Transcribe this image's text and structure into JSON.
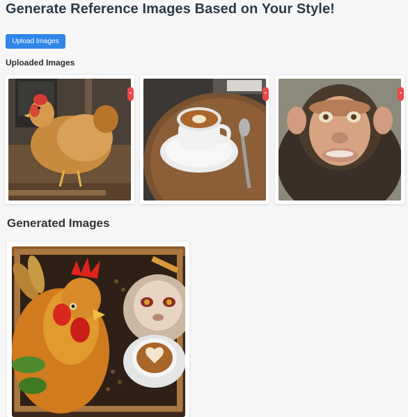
{
  "page": {
    "title": "Generate Reference Images Based on Your Style!"
  },
  "upload": {
    "button_label": "Upload Images"
  },
  "uploaded": {
    "heading": "Uploaded Images",
    "remove_label": "×",
    "items": [
      {
        "subject": "chicken",
        "icon": "chicken-photo"
      },
      {
        "subject": "coffee cup",
        "icon": "coffee-photo"
      },
      {
        "subject": "monkey",
        "icon": "monkey-photo"
      }
    ]
  },
  "generated": {
    "heading": "Generated Images",
    "items": [
      {
        "subject": "rooster, monkey and latte composite",
        "icon": "generated-photo"
      }
    ]
  },
  "colors": {
    "accent": "#2f86e8",
    "remove": "#e9474a",
    "background": "#f6f6f6"
  }
}
